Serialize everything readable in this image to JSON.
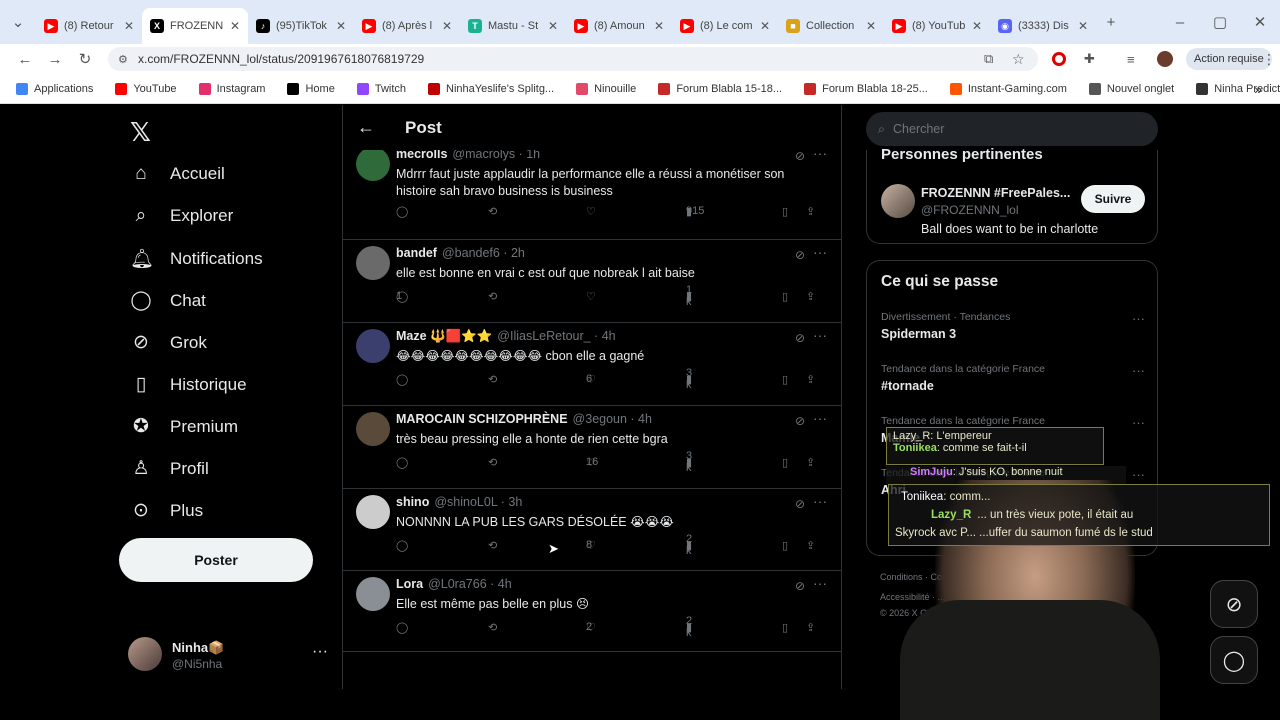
{
  "browser": {
    "tabs": [
      {
        "label": "(8) Retour",
        "color": "#ff0000",
        "glyph": "▶",
        "active": false
      },
      {
        "label": "FROZENNN",
        "color": "#000000",
        "glyph": "X",
        "active": true
      },
      {
        "label": "(95)TikTok",
        "color": "#000000",
        "glyph": "♪",
        "active": false
      },
      {
        "label": "(8) Après l",
        "color": "#ff0000",
        "glyph": "▶",
        "active": false
      },
      {
        "label": "Mastu - St",
        "color": "#19b394",
        "glyph": "T",
        "active": false
      },
      {
        "label": "(8) Amoun",
        "color": "#ff0000",
        "glyph": "▶",
        "active": false
      },
      {
        "label": "(8) Le com",
        "color": "#ff0000",
        "glyph": "▶",
        "active": false
      },
      {
        "label": "Collection",
        "color": "#d8a21b",
        "glyph": "■",
        "active": false
      },
      {
        "label": "(8) YouTub",
        "color": "#ff0000",
        "glyph": "▶",
        "active": false
      },
      {
        "label": "(3333) Dis",
        "color": "#5865f2",
        "glyph": "◉",
        "active": false
      }
    ],
    "url": "x.com/FROZENNN_lol/status/2091967618076819729",
    "profile_action": "Action requise",
    "bookmarks": [
      {
        "label": "Applications",
        "color": "#4285f4"
      },
      {
        "label": "YouTube",
        "color": "#ff0000"
      },
      {
        "label": "Instagram",
        "color": "#e1306c"
      },
      {
        "label": "Home",
        "color": "#000000"
      },
      {
        "label": "Twitch",
        "color": "#9146ff"
      },
      {
        "label": "NinhaYeslife's Splitg...",
        "color": "#c00000"
      },
      {
        "label": "Ninouille",
        "color": "#e24a6c"
      },
      {
        "label": "Forum Blabla 15-18...",
        "color": "#c62828"
      },
      {
        "label": "Forum Blabla 18-25...",
        "color": "#c62828"
      },
      {
        "label": "Instant-Gaming.com",
        "color": "#ff5400"
      },
      {
        "label": "Nouvel onglet",
        "color": "#555555"
      },
      {
        "label": "Ninha Predictions",
        "color": "#333333"
      }
    ]
  },
  "nav": {
    "items": [
      {
        "label": "Accueil",
        "icon": "⌂",
        "icon_name": "home-icon"
      },
      {
        "label": "Explorer",
        "icon": "⌕",
        "icon_name": "search-icon"
      },
      {
        "label": "Notifications",
        "icon": "🔔︎",
        "icon_name": "bell-icon"
      },
      {
        "label": "Chat",
        "icon": "◯",
        "icon_name": "chat-icon"
      },
      {
        "label": "Grok",
        "icon": "⊘",
        "icon_name": "grok-icon"
      },
      {
        "label": "Historique",
        "icon": "▯",
        "icon_name": "bookmark-icon"
      },
      {
        "label": "Premium",
        "icon": "✪",
        "icon_name": "premium-icon"
      },
      {
        "label": "Profil",
        "icon": "♙",
        "icon_name": "profile-icon"
      },
      {
        "label": "Plus",
        "icon": "⊙",
        "icon_name": "more-icon"
      }
    ],
    "post_button": "Poster",
    "account_name": "Ninha📦",
    "account_handle": "@Ni5nha"
  },
  "post": {
    "title": "Post",
    "replies": [
      {
        "name": "mecrolls",
        "handle": "@macrolys · 1h",
        "text": "Mdrrr faut juste applaudir la performance elle a réussi a monétiser son histoire sah bravo business is business",
        "replies": "",
        "likes": "",
        "views": "915",
        "avatar": "#2f6b3a"
      },
      {
        "name": "bandef",
        "handle": "@bandef6 · 2h",
        "text": "elle est bonne en vrai c est ouf que nobreak l ait baise",
        "replies": "1",
        "likes": "",
        "views": "1 k",
        "avatar": "#6a6a6a"
      },
      {
        "name": "Maze 🔱🟥⭐⭐",
        "handle": "@IliasLeRetour_ · 4h",
        "text": "😂😂😂😂😂😂😂😂😂😂 cbon elle a gagné",
        "replies": "",
        "likes": "6",
        "views": "3 k",
        "avatar": "#3b3f6e"
      },
      {
        "name": "MAROCAIN SCHIZOPHRÈNE",
        "handle": "@3egoun · 4h",
        "text": "très beau pressing elle a honte de rien cette bgra",
        "replies": "",
        "likes": "16",
        "views": "3 k",
        "avatar": "#5a4a3a"
      },
      {
        "name": "shino",
        "handle": "@shinoL0L · 3h",
        "text": "NONNNN LA PUB LES GARS DÉSOLÉE 😭😭😭",
        "replies": "",
        "likes": "8",
        "views": "2 k",
        "avatar": "#cccccc"
      },
      {
        "name": "Lora",
        "handle": "@L0ra766 · 4h",
        "text": "Elle est même pas belle en plus 😣",
        "replies": "",
        "likes": "2",
        "views": "2 k",
        "avatar": "#8a8f96"
      }
    ]
  },
  "sidebar": {
    "search_placeholder": "Chercher",
    "relevant_title": "Personnes pertinentes",
    "relevant_name": "FROZENNN #FreePales...",
    "relevant_handle": "@FROZENNN_lol",
    "relevant_bio": "Ball does want to be in charlotte",
    "follow_label": "Suivre",
    "trends_title": "Ce qui se passe",
    "trends": [
      {
        "category": "Divertissement · Tendances",
        "name": "Spiderman 3"
      },
      {
        "category": "Tendance dans la catégorie France",
        "name": "#tornade"
      },
      {
        "category": "Tendance dans la catégorie France",
        "name": "Mamie"
      },
      {
        "category": "Tendance dans la catégorie France",
        "name": "Ahri"
      }
    ],
    "footer_1": "Conditions · Co...",
    "footer_2": "Accessibilité · ...",
    "footer_3": "© 2026 X Corp."
  },
  "overlay": {
    "line1": "Lazy_R: L'empereur",
    "line2_user": "Toniikea",
    "line2": ": comme se fait-t-il",
    "line3_user": "SimJuju",
    "line3": ": J'suis KO, bonne nuit",
    "line4_user": "Toniikea",
    "line4": ": comm...",
    "line5_user": "Lazy_R",
    "line5": "... un très vieux pote, il était au",
    "line6": "Skyrock avc P... ...uffer du saumon fumé ds le stud"
  }
}
